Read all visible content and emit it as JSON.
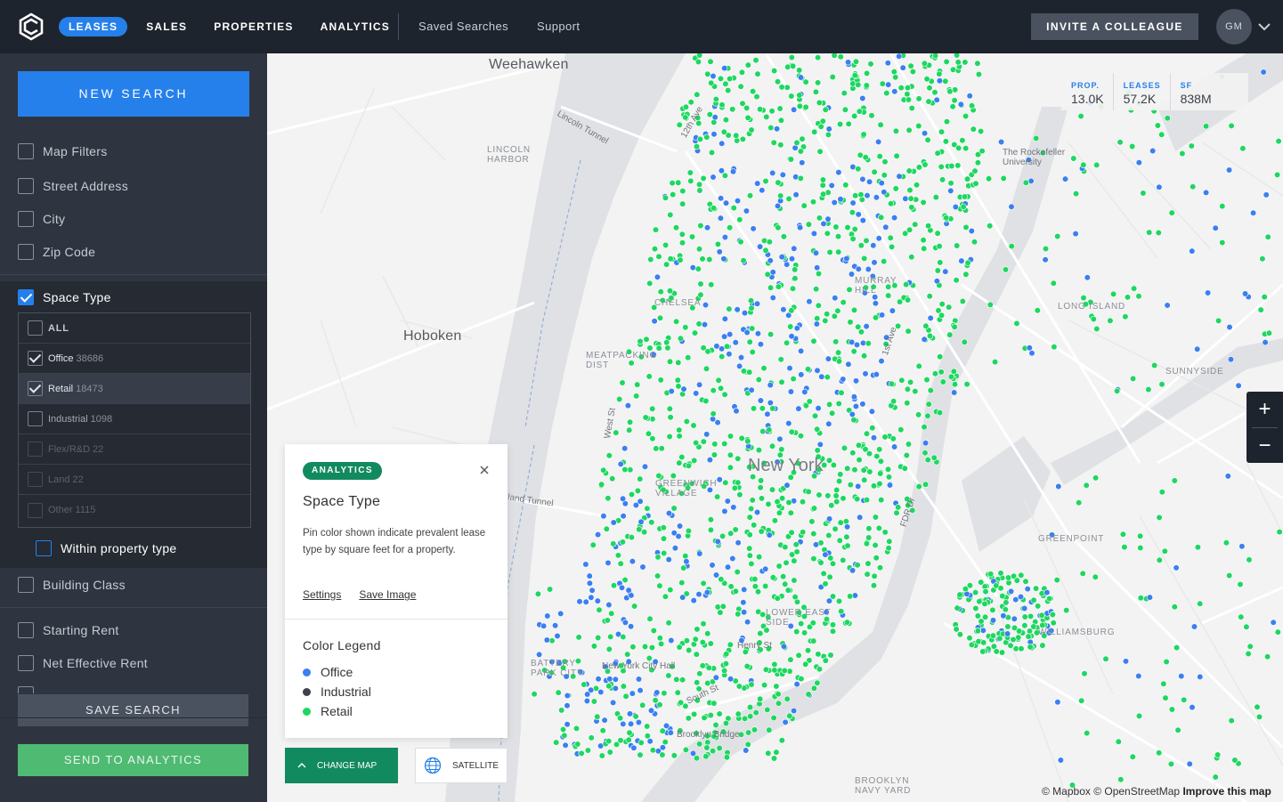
{
  "nav": {
    "items": [
      "LEASES",
      "SALES",
      "PROPERTIES",
      "ANALYTICS"
    ],
    "secondary": [
      "Saved Searches",
      "Support"
    ],
    "invite_label": "INVITE A COLLEAGUE",
    "avatar_initials": "GM"
  },
  "sidebar": {
    "new_search": "NEW SEARCH",
    "filters": [
      "Map Filters",
      "Street Address",
      "City",
      "Zip Code"
    ],
    "space_type": {
      "label": "Space Type",
      "all_label": "ALL",
      "options": [
        {
          "name": "Office",
          "count": "38686",
          "checked": true
        },
        {
          "name": "Retail",
          "count": "18473",
          "checked": true
        },
        {
          "name": "Industrial",
          "count": "1098",
          "checked": false
        },
        {
          "name": "Flex/R&D",
          "count": "22",
          "checked": false
        },
        {
          "name": "Land",
          "count": "22",
          "checked": false
        },
        {
          "name": "Other",
          "count": "1115",
          "checked": false
        }
      ],
      "within_label": "Within property type"
    },
    "building_class": "Building Class",
    "rent_filters": [
      "Starting Rent",
      "Net Effective Rent"
    ],
    "save_search": "SAVE SEARCH",
    "send_analytics": "SEND TO ANALYTICS"
  },
  "stats": {
    "prop_label": "PROP.",
    "prop_value": "13.0K",
    "leases_label": "LEASES",
    "leases_value": "57.2K",
    "sf_label": "SF",
    "sf_value": "838M"
  },
  "map": {
    "labels": {
      "weehawken": "Weehawken",
      "hoboken": "Hoboken",
      "new_york": "New York",
      "lincoln_harbor": "LINCOLN HARBOR",
      "long_island": "LONG ISLAND",
      "sunnyside": "SUNNYSIDE",
      "greenpoint": "GREENPOINT",
      "williamsburg": "WILLIAMSBURG",
      "lower_east_side": "LOWER EAST SIDE",
      "battery_park": "BATTERY PARK CITY",
      "city_hall": "New York City Hall",
      "brooklyn_bridge": "Brooklyn Bridge",
      "brooklyn_navy": "BROOKLYN NAVY YARD",
      "rockefeller": "The Rockefeller University",
      "lincoln_tunnel": "Lincoln Tunnel",
      "holland_tunnel": "land Tunnel",
      "murray_hill": "MURRAY HILL",
      "chelsea": "CHELSEA",
      "meatpacking": "MEATPACKING DIST",
      "greenwich": "GREENWICH VILLAGE",
      "twelfth_ave": "12th Ave",
      "fdr": "FDR Dr",
      "first_ave": "1st Ave",
      "west_st": "West St",
      "south_st": "South St",
      "henry_st": "Henry St"
    },
    "attribution": "© Mapbox © OpenStreetMap",
    "improve": "Improve this map",
    "zoom_in": "+",
    "zoom_out": "−",
    "colors": {
      "office": "#3b7ff0",
      "retail": "#1ed760",
      "water": "#dfe1e4",
      "land": "#f3f3f3"
    }
  },
  "analytics_card": {
    "badge": "ANALYTICS",
    "title": "Space Type",
    "description": "Pin color shown indicate prevalent lease type by square feet for a property.",
    "settings": "Settings",
    "save_image": "Save Image",
    "legend_title": "Color Legend",
    "legend": [
      {
        "label": "Office",
        "color": "#3b7ff0"
      },
      {
        "label": "Industrial",
        "color": "#3d4148"
      },
      {
        "label": "Retail",
        "color": "#1ed760"
      }
    ]
  },
  "map_controls": {
    "change_map": "CHANGE MAP",
    "satellite": "SATELLITE"
  }
}
